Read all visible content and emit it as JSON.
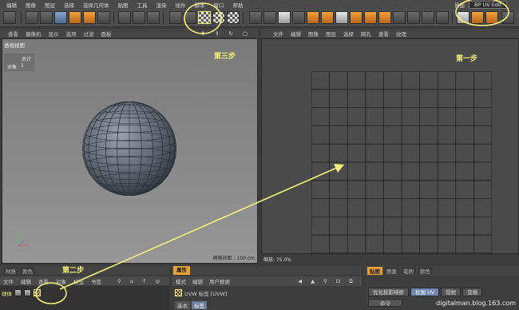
{
  "menubar": {
    "items": [
      "编辑",
      "图像",
      "图层",
      "选择",
      "选择几何体",
      "贴图",
      "工具",
      "渲染",
      "插件",
      "脚本",
      "窗口",
      "帮助"
    ],
    "layout_label": "界面",
    "layout_value": "BP UV Edit"
  },
  "viewport": {
    "menu": [
      "查看",
      "摄像机",
      "显示",
      "选项",
      "过滤",
      "面板"
    ],
    "view_label": "透视视图",
    "stats_header": "总计",
    "stats_key": "对象",
    "stats_value": "1",
    "grid_info": "网格间距 : 100 cm",
    "step_label": "第三步"
  },
  "uv_editor": {
    "menu": [
      "文件",
      "编辑",
      "图像",
      "图层",
      "选择",
      "网孔",
      "查看",
      "纹理"
    ],
    "step_label": "第一步",
    "zoom": "缩放: 75.0%",
    "grid_cells": 10
  },
  "materials": {
    "tabs": [
      "材质",
      "颜色"
    ],
    "menu": [
      "文件",
      "编辑",
      "查看",
      "对象",
      "标签",
      "书签"
    ],
    "object_name": "球体",
    "step_label": "第二步"
  },
  "attributes": {
    "tab": "属性",
    "menu": [
      "模式",
      "编辑",
      "用户数据"
    ],
    "row_label": "UVW 标签 [UVW]",
    "sub_tabs": [
      "基本",
      "标签"
    ]
  },
  "texture_tools": {
    "tabs": [
      "贴图",
      "图案",
      "笔刷",
      "颜色"
    ],
    "buttons": [
      "优化投影映射",
      "松弛 UV",
      "投射",
      "变换"
    ],
    "command": "命令"
  },
  "watermark": "digitalman.blog.163.com",
  "colors": {
    "annotation": "#f5f07a",
    "accent": "#e8a23a"
  }
}
